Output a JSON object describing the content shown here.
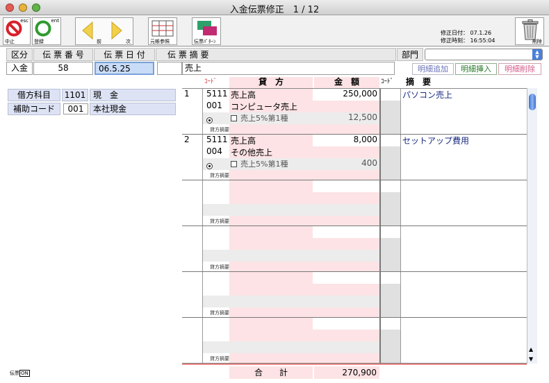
{
  "window": {
    "title": "入金伝票修正　1 / 12"
  },
  "toolbar": {
    "stop_hint": "esc",
    "stop_label": "中止",
    "register_hint": "ent",
    "register_label": "登録",
    "prev_label": "前",
    "next_label": "次",
    "ledger_label": "元帳参照",
    "pattern_label": "伝票ﾊﾟﾀｰﾝ",
    "delete_label": "削除",
    "mod_date_label": "修正日付：",
    "mod_date": "07.1.26",
    "mod_time_label": "修正時刻：",
    "mod_time": "16:55:04"
  },
  "header": {
    "kubun_label": "区分",
    "number_label": "伝 票 番 号",
    "date_label": "伝 票 日 付",
    "summary_label": "伝 票 摘 要",
    "dept_label": "部門",
    "kubun_value": "入金",
    "number_value": "58",
    "date_value": "06.5.25",
    "summary_value": "売上",
    "dept_value": ""
  },
  "actions": {
    "add": "明細追加",
    "insert": "明細挿入",
    "delete": "明細削除"
  },
  "left": {
    "debit_label": "借方科目",
    "debit_code": "1101",
    "debit_name": "現　金",
    "aux_label": "補助コード",
    "aux_code": "001",
    "aux_name": "本社現金"
  },
  "grid": {
    "col_code": "ｺｰﾄﾞ",
    "col_credit": "貸　方",
    "col_amount": "金　額",
    "col_code2": "ｺｰﾄﾞ",
    "col_summary": "摘　要",
    "credit_summary_label": "貸方摘要",
    "rows": [
      {
        "no": "1",
        "code": "5111",
        "account": "売上高",
        "amount": "250,000",
        "sub_code": "001",
        "sub_name": "コンピュータ売上",
        "tax": "売上5%第1種",
        "tax_amount": "12,500",
        "summary": "パソコン売上"
      },
      {
        "no": "2",
        "code": "5111",
        "account": "売上高",
        "amount": "8,000",
        "sub_code": "004",
        "sub_name": "その他売上",
        "tax": "売上5%第1種",
        "tax_amount": "400",
        "summary": "セットアップ費用"
      },
      {
        "no": "",
        "code": "",
        "account": "",
        "amount": "",
        "sub_code": "",
        "sub_name": "",
        "tax": "",
        "tax_amount": "",
        "summary": ""
      },
      {
        "no": "",
        "code": "",
        "account": "",
        "amount": "",
        "sub_code": "",
        "sub_name": "",
        "tax": "",
        "tax_amount": "",
        "summary": ""
      },
      {
        "no": "",
        "code": "",
        "account": "",
        "amount": "",
        "sub_code": "",
        "sub_name": "",
        "tax": "",
        "tax_amount": "",
        "summary": ""
      },
      {
        "no": "",
        "code": "",
        "account": "",
        "amount": "",
        "sub_code": "",
        "sub_name": "",
        "tax": "",
        "tax_amount": "",
        "summary": ""
      }
    ],
    "total_label": "合　　計",
    "total_value": "270,900"
  },
  "status": {
    "label": "伝票",
    "state": "ON"
  }
}
